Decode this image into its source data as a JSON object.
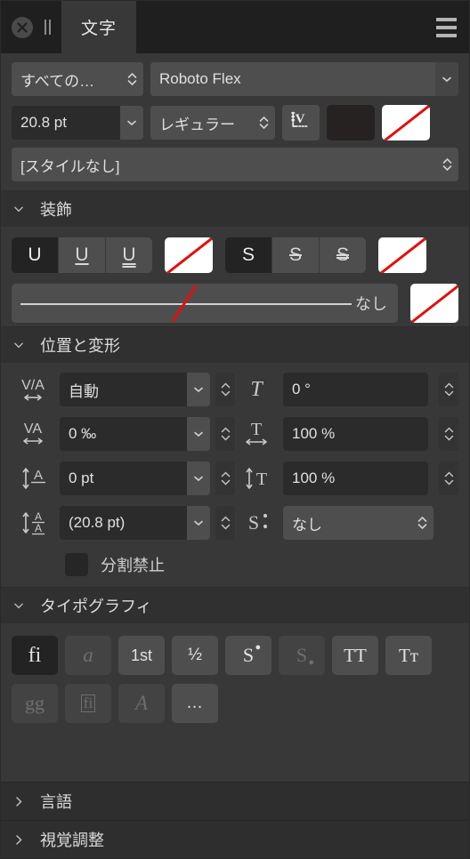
{
  "window": {
    "tab_label": "文字",
    "close_icon": "close-circle-icon",
    "grip_icon": "drag-grip-icon",
    "menu_icon": "hamburger-menu-icon"
  },
  "font_row": {
    "family_filter_value": "すべての…",
    "font_name_value": "Roboto Flex"
  },
  "size_row": {
    "size_value": "20.8 pt",
    "weight_value": "レギュラー",
    "vertical_text_icon": "vertical-text-icon",
    "fill_color": "#262222",
    "stroke_color_label": "none",
    "stroke_color": "#ffffff",
    "slash_color": "#e10f0f"
  },
  "style_row": {
    "text_style_value": "[スタイルなし]"
  },
  "sections": {
    "decoration": {
      "title": "装飾",
      "expanded": true,
      "underline_buttons": [
        {
          "label": "U",
          "name": "underline-none-button",
          "active": true
        },
        {
          "label": "U",
          "name": "underline-single-button",
          "active": false
        },
        {
          "label": "U",
          "name": "underline-double-button",
          "active": false
        }
      ],
      "underline_color_label": "none",
      "strike_buttons": [
        {
          "label": "S",
          "name": "strikethrough-none-button",
          "active": true
        },
        {
          "label": "S",
          "name": "strikethrough-single-button",
          "active": false
        },
        {
          "label": "S",
          "name": "strikethrough-double-button",
          "active": false
        }
      ],
      "strike_color_label": "none",
      "line_style_label": "なし",
      "line_color_label": "none"
    },
    "position": {
      "title": "位置と変形",
      "expanded": true,
      "fields": [
        {
          "icon": "kerning-icon",
          "icon_text": "V/A",
          "value": "自動",
          "name": "kerning-field",
          "stepper": true,
          "dropdown": true
        },
        {
          "icon": "rotation-icon",
          "icon_text": "T",
          "value": "0 °",
          "name": "character-rotation-field",
          "stepper": true,
          "dropdown": false
        },
        {
          "icon": "tracking-icon",
          "icon_text": "VA",
          "value": "0 ‰",
          "name": "tracking-field",
          "stepper": true,
          "dropdown": true
        },
        {
          "icon": "horizontal-scale-icon",
          "icon_text": "T",
          "value": "100 %",
          "name": "horizontal-scale-field",
          "stepper": true,
          "dropdown": false
        },
        {
          "icon": "baseline-shift-icon",
          "icon_text": "A",
          "value": "0 pt",
          "name": "baseline-shift-field",
          "stepper": true,
          "dropdown": true
        },
        {
          "icon": "vertical-scale-icon",
          "icon_text": "T",
          "value": "100 %",
          "name": "vertical-scale-field",
          "stepper": true,
          "dropdown": false
        },
        {
          "icon": "leading-icon",
          "icon_text": "A/A",
          "value": "(20.8 pt)",
          "name": "leading-field",
          "stepper": true,
          "dropdown": true
        },
        {
          "icon": "position-icon",
          "icon_text": "S",
          "value": "なし",
          "name": "position-field",
          "stepper": false,
          "dropdown": false
        }
      ],
      "no_break_label": "分割禁止",
      "no_break_checked": false
    },
    "typography": {
      "title": "タイポグラフィ",
      "expanded": true,
      "row1": [
        {
          "label": "fi",
          "name": "standard-ligatures-button",
          "state": "active"
        },
        {
          "label": "a",
          "name": "contextual-alternates-button",
          "state": "disabled"
        },
        {
          "label": "1st",
          "name": "ordinals-button",
          "state": "normal"
        },
        {
          "label": "½",
          "name": "fractions-button",
          "state": "normal"
        },
        {
          "label": "S",
          "name": "superscript-button",
          "state": "normal"
        },
        {
          "label": "S",
          "name": "subscript-button",
          "state": "disabled"
        },
        {
          "label": "TT",
          "name": "all-caps-button",
          "state": "normal"
        },
        {
          "label": "Tт",
          "name": "small-caps-button",
          "state": "normal"
        }
      ],
      "row2": [
        {
          "label": "gg",
          "name": "alternate-glyphs-button",
          "state": "disabled"
        },
        {
          "label": "fi",
          "name": "discretionary-ligatures-button",
          "state": "disabled"
        },
        {
          "label": "A",
          "name": "swash-button",
          "state": "disabled"
        },
        {
          "label": "…",
          "name": "more-typography-button",
          "state": "normal"
        }
      ]
    },
    "language": {
      "title": "言語",
      "expanded": false
    },
    "optical": {
      "title": "視覚調整",
      "expanded": false
    }
  }
}
